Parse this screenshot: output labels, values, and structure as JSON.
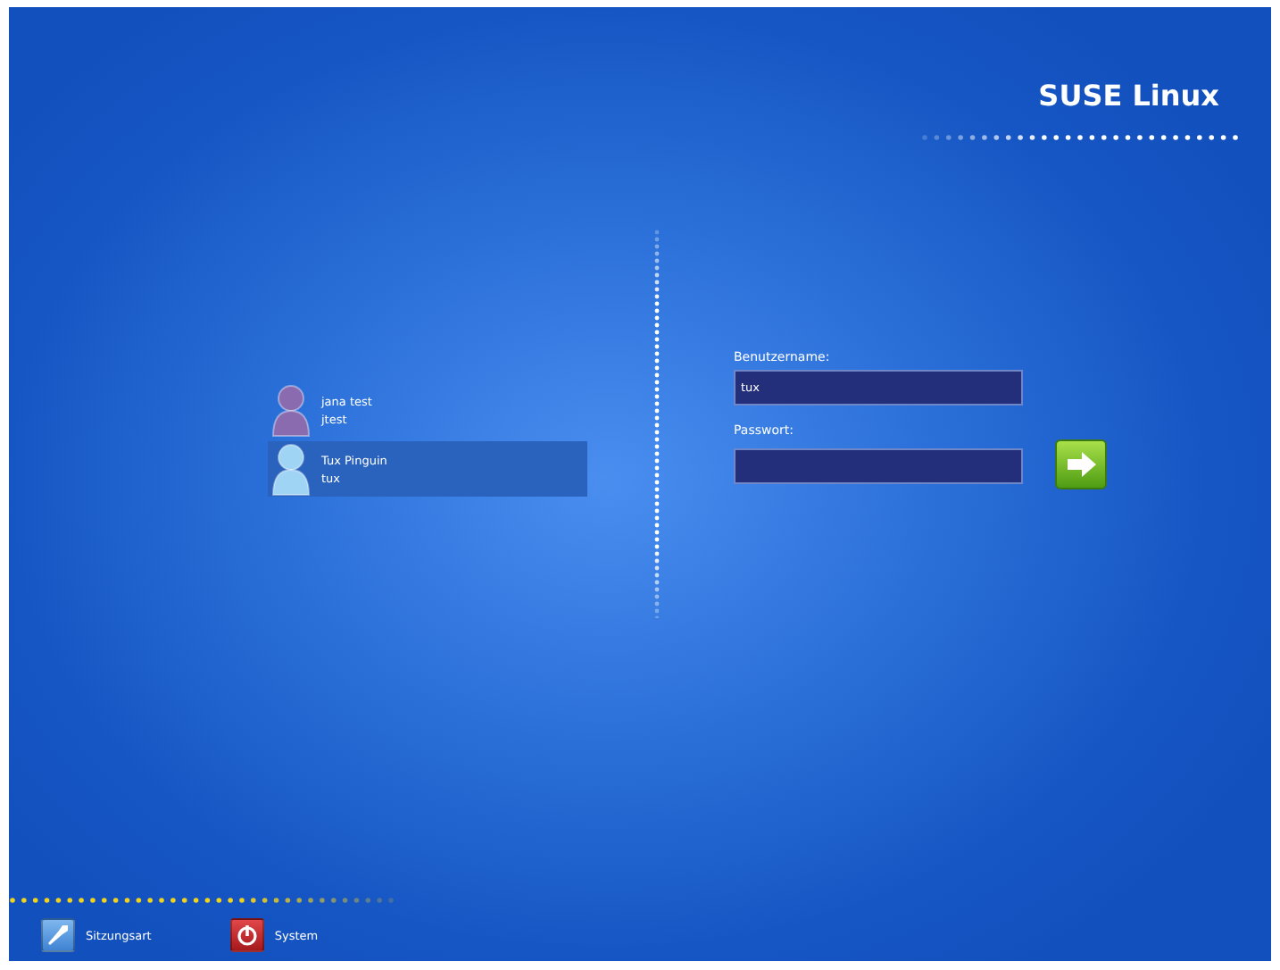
{
  "logo": "SUSE Linux",
  "users": [
    {
      "name": "jana test",
      "login": "jtest",
      "selected": false,
      "color": "#8a6bb0"
    },
    {
      "name": "Tux Pinguin",
      "login": "tux",
      "selected": true,
      "color": "#9fd4f5"
    }
  ],
  "form": {
    "username_label": "Benutzername:",
    "username_value": "tux",
    "password_label": "Passwort:"
  },
  "bottom": [
    {
      "kind": "session",
      "label": "Sitzungsart"
    },
    {
      "kind": "system",
      "label": "System"
    }
  ]
}
